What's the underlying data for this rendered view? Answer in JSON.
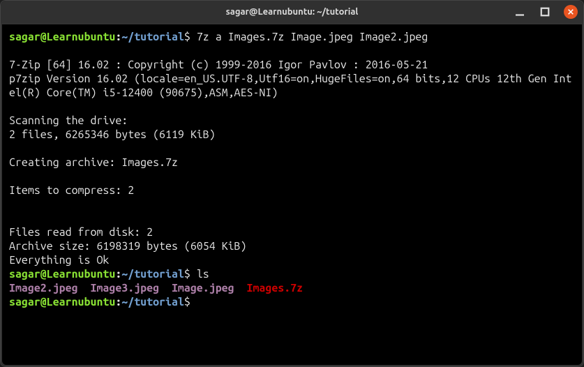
{
  "titlebar": {
    "title": "sagar@Learnubuntu: ~/tutorial"
  },
  "prompt": {
    "user_host": "sagar@Learnubuntu",
    "colon": ":",
    "path": "~/tutorial",
    "dollar": "$"
  },
  "cmd1": " 7z a Images.7z Image.jpeg Image2.jpeg",
  "output": {
    "l1": "7-Zip [64] 16.02 : Copyright (c) 1999-2016 Igor Pavlov : 2016-05-21",
    "l2": "p7zip Version 16.02 (locale=en_US.UTF-8,Utf16=on,HugeFiles=on,64 bits,12 CPUs 12th Gen Intel(R) Core(TM) i5-12400 (90675),ASM,AES-NI)",
    "l4": "Scanning the drive:",
    "l5": "2 files, 6265346 bytes (6119 KiB)",
    "l7": "Creating archive: Images.7z",
    "l9": "Items to compress: 2",
    "l12": "Files read from disk: 2",
    "l13": "Archive size: 6198319 bytes (6054 KiB)",
    "l14": "Everything is Ok"
  },
  "cmd2": " ls",
  "ls": {
    "f1": "Image2.jpeg",
    "f2": "Image3.jpeg",
    "f3": "Image.jpeg",
    "f4": "Images.7z"
  }
}
